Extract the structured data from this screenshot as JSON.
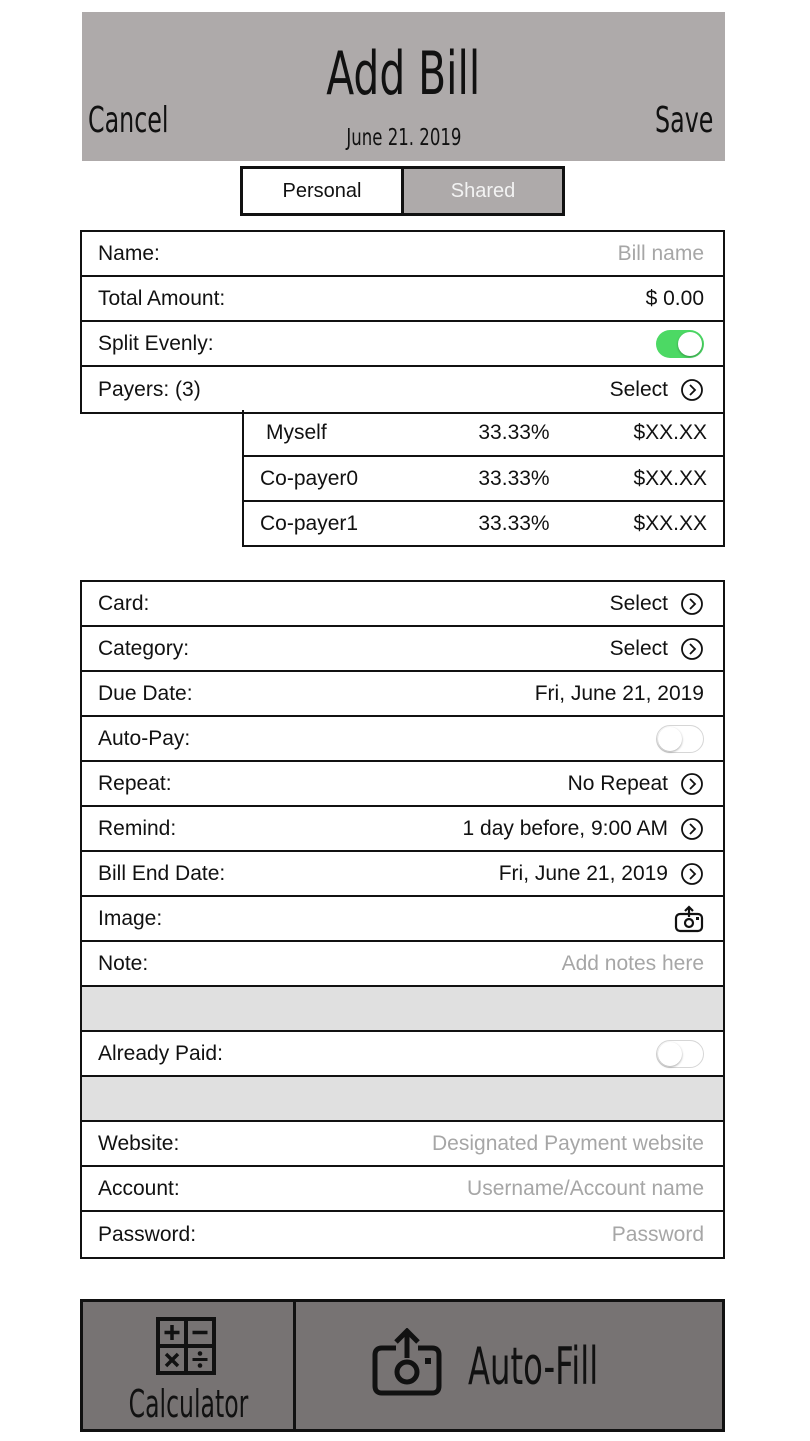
{
  "header": {
    "title": "Add Bill",
    "date": "June 21. 2019",
    "cancel_label": "Cancel",
    "save_label": "Save"
  },
  "segment": {
    "personal": "Personal",
    "shared": "Shared",
    "selected": "Shared"
  },
  "group1": {
    "name_label": "Name:",
    "name_placeholder": "Bill name",
    "total_label": "Total Amount:",
    "total_value": "$ 0.00",
    "split_label": "Split Evenly:",
    "split_on": true,
    "payers_label": "Payers: (3)",
    "payers_action": "Select"
  },
  "payers": [
    {
      "name": "Myself",
      "share": "33.33%",
      "amount": "$XX.XX"
    },
    {
      "name": "Co-payer0",
      "share": "33.33%",
      "amount": "$XX.XX"
    },
    {
      "name": "Co-payer1",
      "share": "33.33%",
      "amount": "$XX.XX"
    }
  ],
  "group2": {
    "card_label": "Card:",
    "card_value": "Select",
    "category_label": "Category:",
    "category_value": "Select",
    "due_label": "Due Date:",
    "due_value": "Fri, June 21, 2019",
    "autopay_label": "Auto-Pay:",
    "autopay_on": false,
    "repeat_label": "Repeat:",
    "repeat_value": "No Repeat",
    "remind_label": "Remind:",
    "remind_value": "1 day before, 9:00 AM",
    "end_label": "Bill End Date:",
    "end_value": "Fri, June 21, 2019",
    "image_label": "Image:",
    "note_label": "Note:",
    "note_placeholder": "Add notes here",
    "paid_label": "Already Paid:",
    "paid_on": false,
    "website_label": "Website:",
    "website_placeholder": "Designated Payment website",
    "account_label": "Account:",
    "account_placeholder": "Username/Account name",
    "password_label": "Password:",
    "password_placeholder": "Password"
  },
  "bottom": {
    "calculator_label": "Calculator",
    "autofill_label": "Auto-Fill"
  },
  "colors": {
    "header_bg": "#aeaaaa",
    "bottom_bg": "#777373",
    "toggle_on": "#4cd964",
    "placeholder": "#a6a6a6"
  }
}
